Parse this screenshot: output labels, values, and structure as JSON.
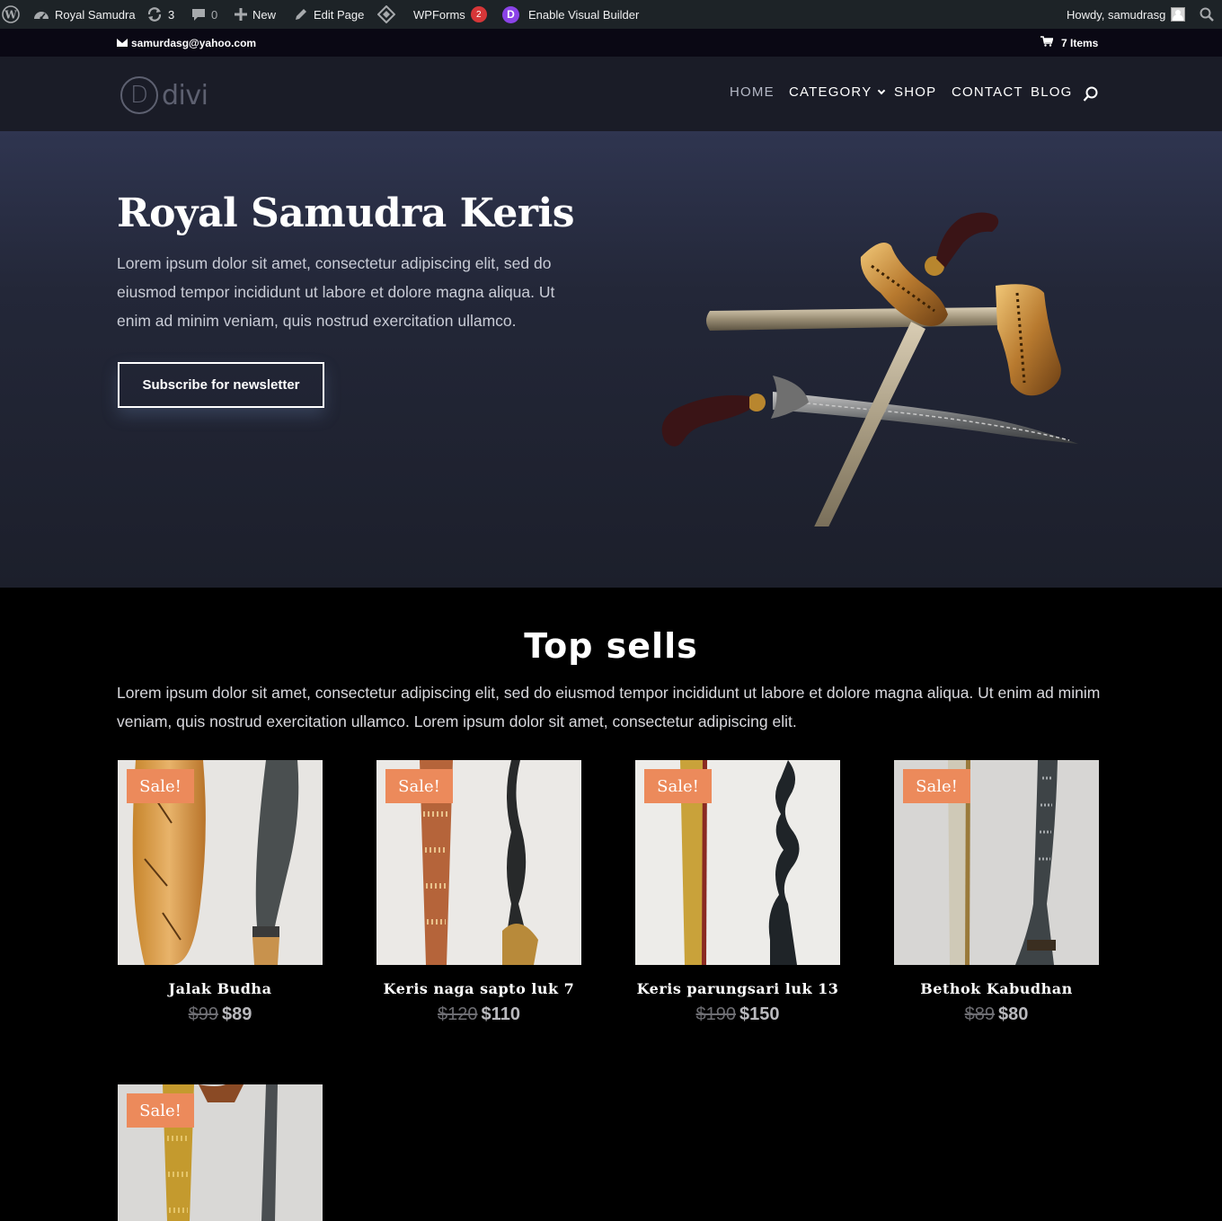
{
  "admin_bar": {
    "site_name": "Royal Samudra",
    "updates_count": "3",
    "comments_count": "0",
    "new_label": "New",
    "edit_label": "Edit Page",
    "wpforms_label": "WPForms",
    "wpforms_badge": "2",
    "visual_builder_label": "Enable Visual Builder",
    "howdy": "Howdy, samudrasg"
  },
  "top_bar": {
    "email": "samurdasg@yahoo.com",
    "cart": "7 Items"
  },
  "header": {
    "logo_letter": "D",
    "logo_text": "divi",
    "nav": {
      "home": "HOME",
      "category": "CATEGORY",
      "shop": "SHOP",
      "contact": "CONTACT",
      "blog": "BLOG"
    }
  },
  "hero": {
    "title": "Royal Samudra Keris",
    "text": "Lorem ipsum dolor sit amet, consectetur adipiscing elit, sed do eiusmod tempor incididunt ut labore et dolore magna aliqua. Ut enim ad minim veniam, quis nostrud exercitation ullamco.",
    "button": "Subscribe for newsletter"
  },
  "top_sells": {
    "title": "Top sells",
    "text": "Lorem ipsum dolor sit amet, consectetur adipiscing elit, sed do eiusmod tempor incididunt ut labore et dolore magna aliqua. Ut enim ad minim veniam, quis nostrud exercitation ullamco. Lorem ipsum dolor sit amet, consectetur adipiscing elit.",
    "products": [
      {
        "badge": "Sale!",
        "name": "Jalak Budha",
        "old_price": "$99",
        "price": "$89"
      },
      {
        "badge": "Sale!",
        "name": "Keris naga sapto luk 7",
        "old_price": "$120",
        "price": "$110"
      },
      {
        "badge": "Sale!",
        "name": "Keris parungsari luk 13",
        "old_price": "$190",
        "price": "$150"
      },
      {
        "badge": "Sale!",
        "name": "Bethok Kabudhan",
        "old_price": "$89",
        "price": "$80"
      },
      {
        "badge": "Sale!"
      }
    ]
  },
  "colors": {
    "admin_bar": "#1d2327",
    "top_bar": "#0a0814",
    "header": "#1a1c27",
    "sale_badge": "#ec8a5b"
  }
}
